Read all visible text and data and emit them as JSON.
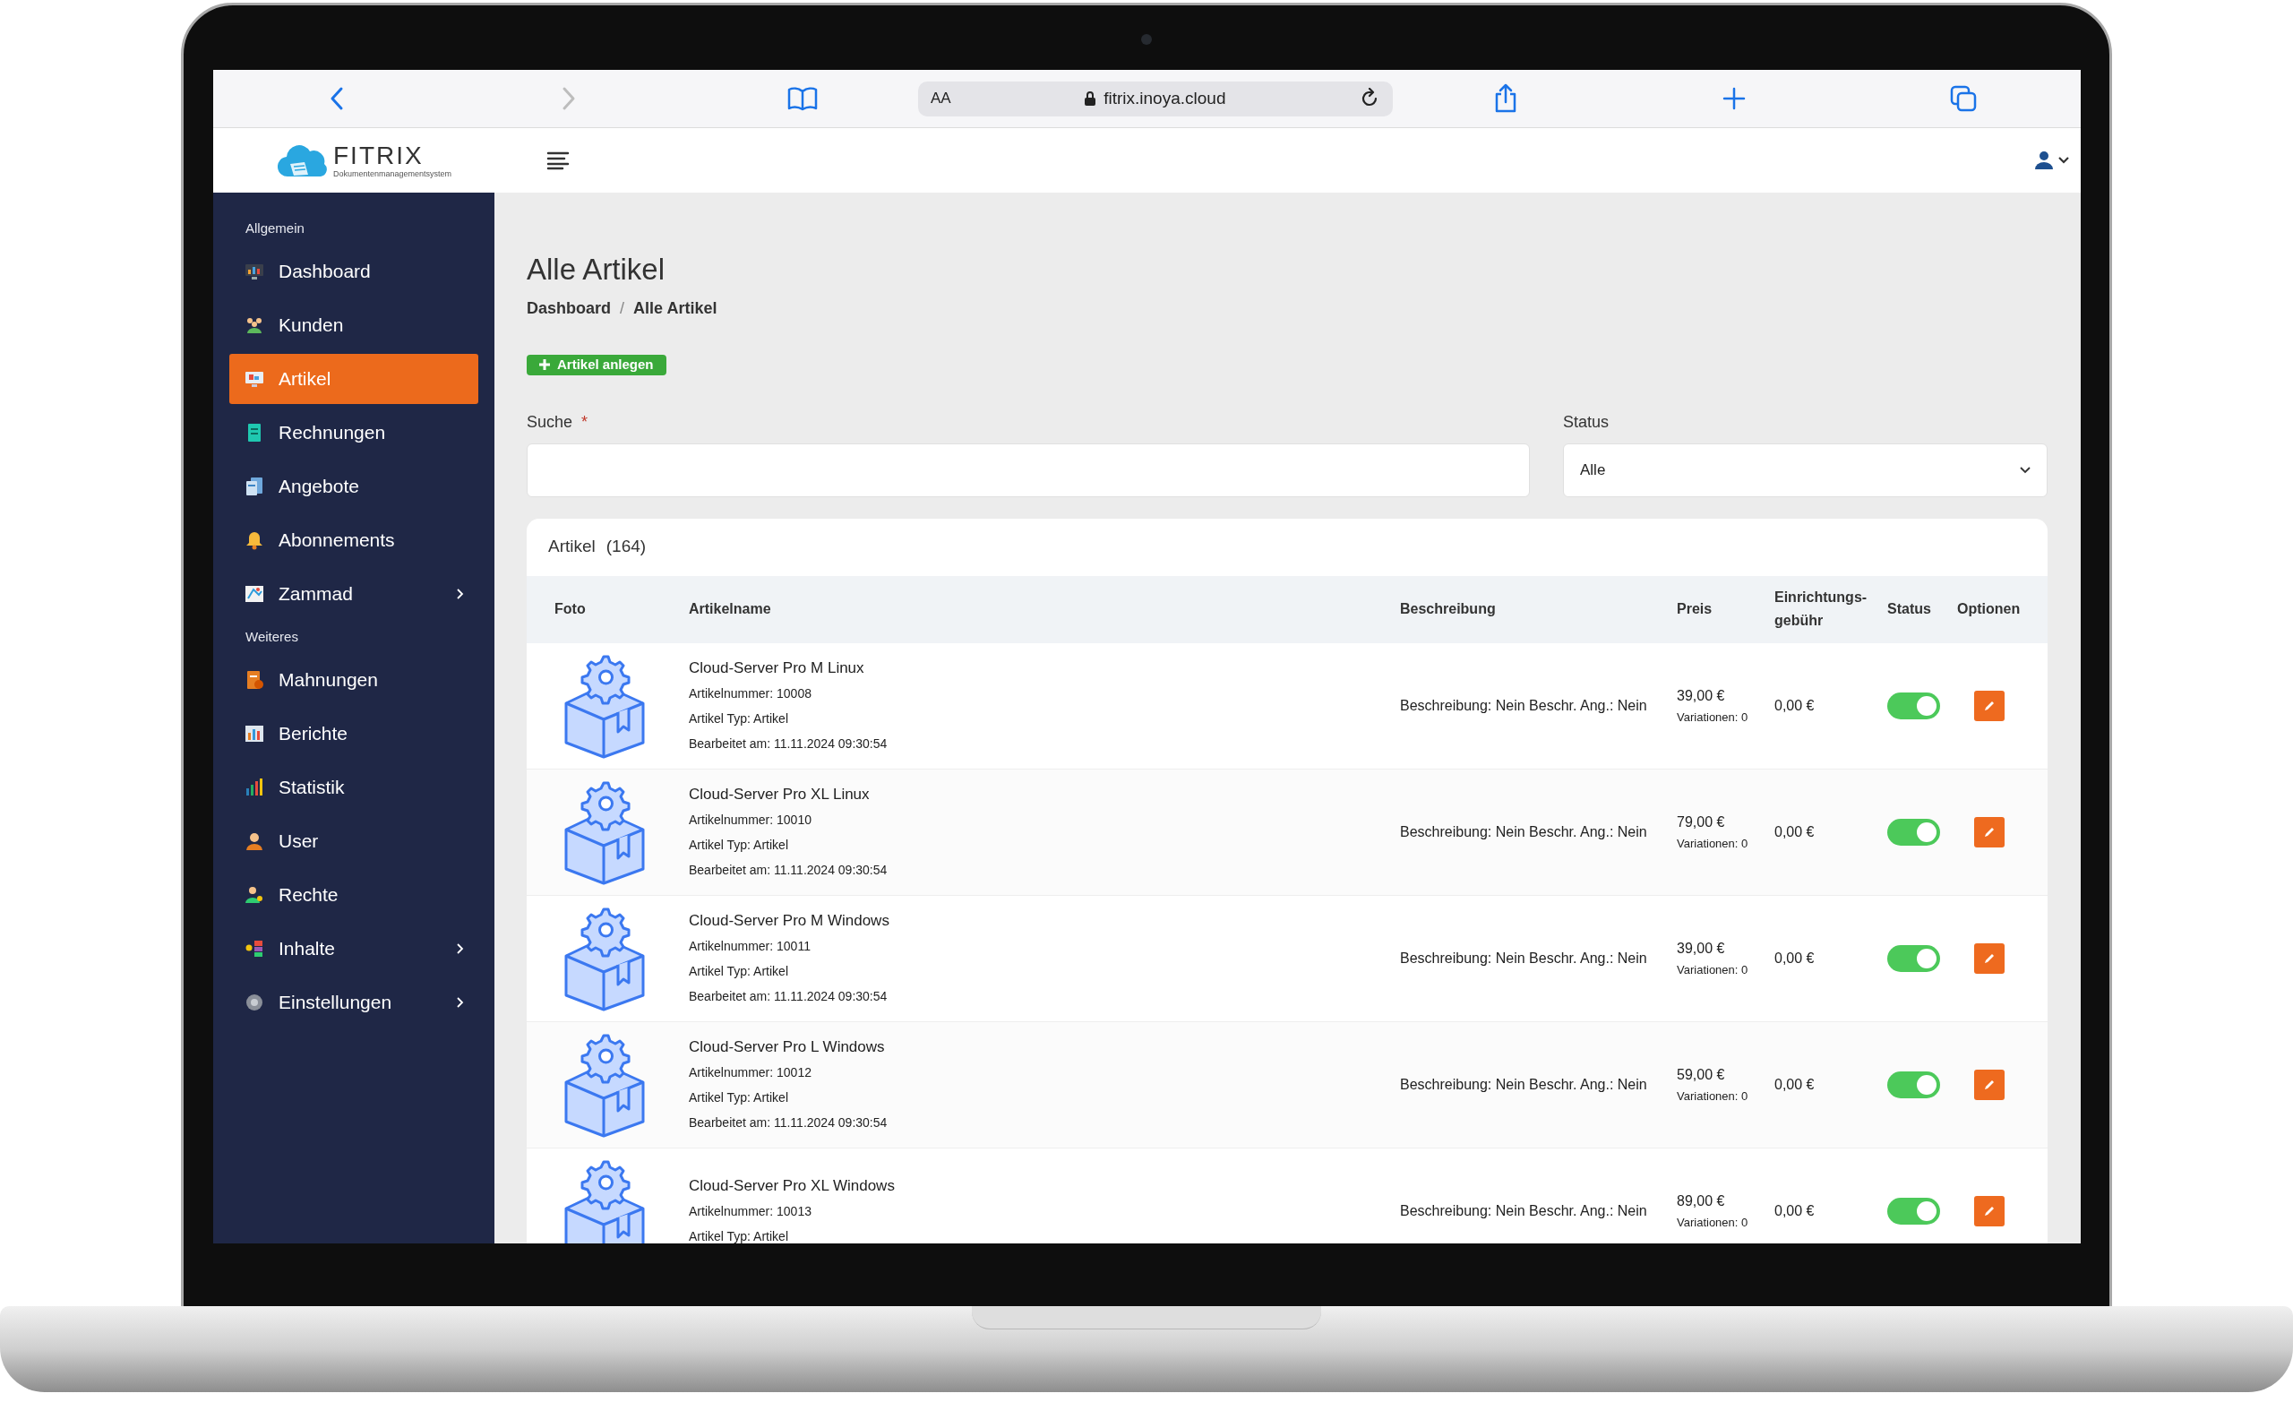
{
  "browser": {
    "reader_button": "AA",
    "address": "fitrix.inoya.cloud"
  },
  "header": {
    "logo_text": "FITRIX",
    "logo_subtitle": "Dokumentenmanagementsystem"
  },
  "sidebar": {
    "sections": [
      {
        "title": "Allgemein",
        "items": [
          {
            "label": "Dashboard",
            "selected": false,
            "expandable": false
          },
          {
            "label": "Kunden",
            "selected": false,
            "expandable": false
          },
          {
            "label": "Artikel",
            "selected": true,
            "expandable": false
          },
          {
            "label": "Rechnungen",
            "selected": false,
            "expandable": false
          },
          {
            "label": "Angebote",
            "selected": false,
            "expandable": false
          },
          {
            "label": "Abonnements",
            "selected": false,
            "expandable": false
          },
          {
            "label": "Zammad",
            "selected": false,
            "expandable": true
          }
        ]
      },
      {
        "title": "Weiteres",
        "items": [
          {
            "label": "Mahnungen",
            "selected": false,
            "expandable": false
          },
          {
            "label": "Berichte",
            "selected": false,
            "expandable": false
          },
          {
            "label": "Statistik",
            "selected": false,
            "expandable": false
          },
          {
            "label": "User",
            "selected": false,
            "expandable": false
          },
          {
            "label": "Rechte",
            "selected": false,
            "expandable": false
          },
          {
            "label": "Inhalte",
            "selected": false,
            "expandable": true
          },
          {
            "label": "Einstellungen",
            "selected": false,
            "expandable": true
          }
        ]
      }
    ]
  },
  "page": {
    "title": "Alle Artikel",
    "breadcrumb": [
      "Dashboard",
      "Alle Artikel"
    ],
    "breadcrumb_separator": "/",
    "create_button": "Artikel anlegen"
  },
  "filters": {
    "search_label": "Suche",
    "required_mark": "*",
    "status_label": "Status",
    "status_value": "Alle"
  },
  "table": {
    "title": "Artikel",
    "count": "(164)",
    "columns": [
      "Foto",
      "Artikelname",
      "Beschreibung",
      "Preis",
      "Einrichtungs-\ngebühr",
      "Status",
      "Optionen"
    ],
    "rows": [
      {
        "name": "Cloud-Server Pro M Linux",
        "number": "Artikelnummer: 10008",
        "type": "Artikel Typ: Artikel",
        "edited": "Bearbeitet am: 11.11.2024 09:30:54",
        "description": "Beschreibung: Nein Beschr. Ang.: Nein",
        "price": "39,00 €",
        "variations": "Variationen: 0",
        "setup_fee": "0,00 €",
        "active": true
      },
      {
        "name": "Cloud-Server Pro XL Linux",
        "number": "Artikelnummer: 10010",
        "type": "Artikel Typ: Artikel",
        "edited": "Bearbeitet am: 11.11.2024 09:30:54",
        "description": "Beschreibung: Nein Beschr. Ang.: Nein",
        "price": "79,00 €",
        "variations": "Variationen: 0",
        "setup_fee": "0,00 €",
        "active": true
      },
      {
        "name": "Cloud-Server Pro M Windows",
        "number": "Artikelnummer: 10011",
        "type": "Artikel Typ: Artikel",
        "edited": "Bearbeitet am: 11.11.2024 09:30:54",
        "description": "Beschreibung: Nein Beschr. Ang.: Nein",
        "price": "39,00 €",
        "variations": "Variationen: 0",
        "setup_fee": "0,00 €",
        "active": true
      },
      {
        "name": "Cloud-Server Pro L Windows",
        "number": "Artikelnummer: 10012",
        "type": "Artikel Typ: Artikel",
        "edited": "Bearbeitet am: 11.11.2024 09:30:54",
        "description": "Beschreibung: Nein Beschr. Ang.: Nein",
        "price": "59,00 €",
        "variations": "Variationen: 0",
        "setup_fee": "0,00 €",
        "active": true
      },
      {
        "name": "Cloud-Server Pro XL Windows",
        "number": "Artikelnummer: 10013",
        "type": "Artikel Typ: Artikel",
        "description": "Beschreibung: Nein Beschr. Ang.: Nein",
        "price": "89,00 €",
        "variations": "Variationen: 0",
        "setup_fee": "0,00 €",
        "active": true
      }
    ]
  }
}
